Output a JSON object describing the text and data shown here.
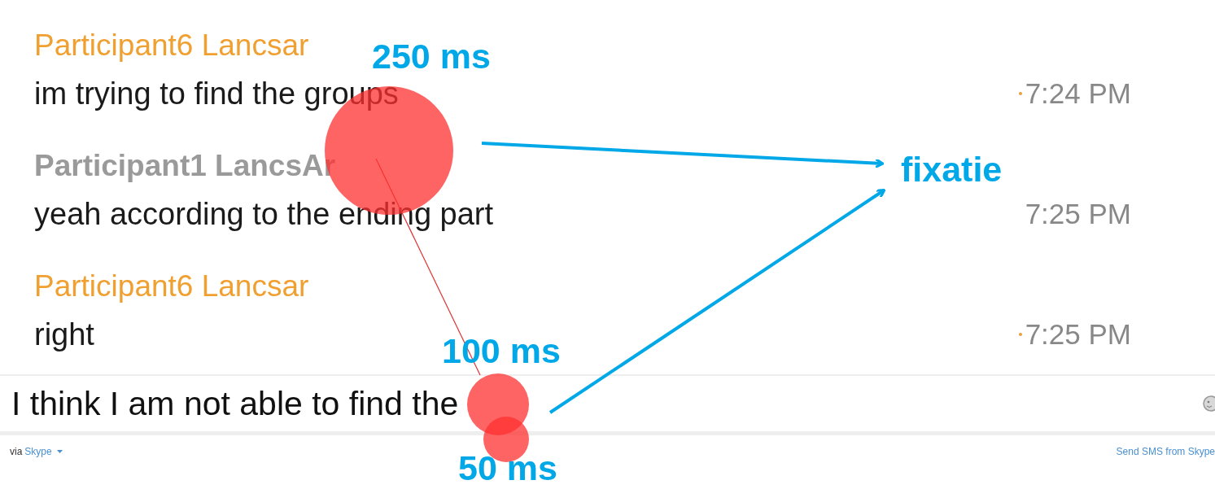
{
  "messages": [
    {
      "sender": "Participant6 Lancsar",
      "color": "#f0a030",
      "kind": "other",
      "text": "im trying to find the groups",
      "time": "7:24 PM",
      "dot": true
    },
    {
      "sender": "Participant1 LancsAr",
      "color": "#9a9a9a",
      "kind": "own",
      "text": "yeah according to the ending part",
      "time": "7:25 PM",
      "dot": false
    },
    {
      "sender": "Participant6 Lancsar",
      "color": "#f0a030",
      "kind": "other",
      "text": "right",
      "time": "7:25 PM",
      "dot": true
    }
  ],
  "input": {
    "value": "I think I am not able to find the"
  },
  "footer": {
    "via": "via",
    "service": "Skype",
    "link": "Send SMS from Skype"
  },
  "annotations": {
    "fixations": [
      {
        "label": "250 ms"
      },
      {
        "label": "100 ms"
      },
      {
        "label": "50 ms"
      }
    ],
    "target_label": "fixatie"
  }
}
